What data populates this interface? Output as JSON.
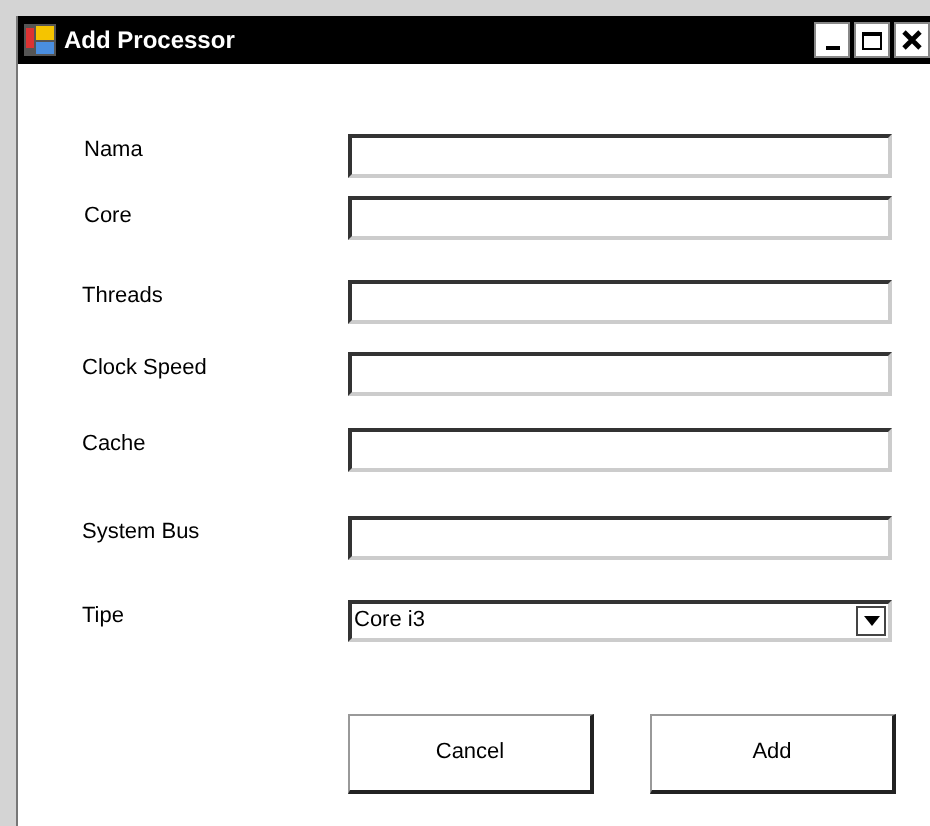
{
  "window": {
    "title": "Add Processor"
  },
  "fields": [
    {
      "kind": "text",
      "label": "Nama"
    },
    {
      "kind": "text",
      "label": "Core"
    },
    {
      "kind": "text",
      "label": "Threads"
    },
    {
      "kind": "text",
      "label": "Clock Speed"
    },
    {
      "kind": "text",
      "label": "Cache"
    },
    {
      "kind": "text",
      "label": "System Bus"
    },
    {
      "kind": "dropdown",
      "label": "Tipe",
      "value": "Core i3"
    }
  ],
  "buttons": [
    "Cancel",
    "Add"
  ]
}
